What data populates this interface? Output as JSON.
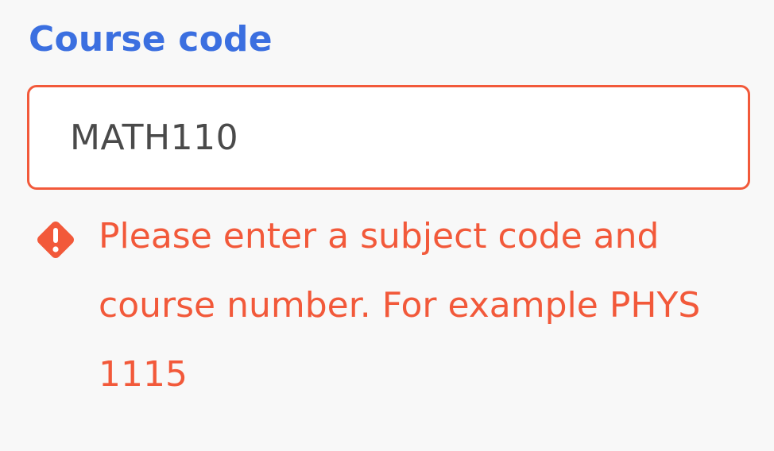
{
  "field": {
    "label": "Course code",
    "value": "MATH110",
    "placeholder": ""
  },
  "error": {
    "icon": "error-diamond-icon",
    "message": "Please enter a subject code and course number. For example PHYS 1115"
  },
  "colors": {
    "label": "#3b6fe0",
    "error": "#f2593a",
    "input_text": "#4a4a4a",
    "background": "#f8f8f8"
  }
}
